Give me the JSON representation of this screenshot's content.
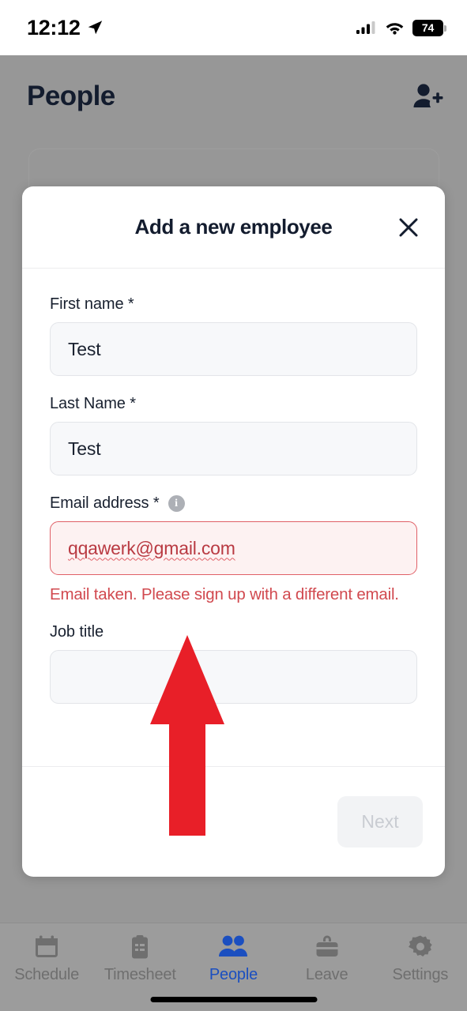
{
  "status_bar": {
    "time": "12:12",
    "location_icon": "location-arrow-icon",
    "cellular_icon": "cellular-bars-icon",
    "wifi_icon": "wifi-icon",
    "battery_level": "74"
  },
  "app_header": {
    "title": "People",
    "add_person_icon": "add-person-icon"
  },
  "modal": {
    "title": "Add a new employee",
    "close_icon": "close-x-icon",
    "fields": [
      {
        "label": "First name *",
        "value": "Test",
        "placeholder": "",
        "state": "normal"
      },
      {
        "label": "Last Name *",
        "value": "Test",
        "placeholder": "",
        "state": "normal"
      },
      {
        "label": "Email address *",
        "value": "qqawerk@gmail.com",
        "placeholder": "",
        "state": "error",
        "info_icon": "info-circle-icon",
        "error_message": "Email taken. Please sign up with a different email."
      },
      {
        "label": "Job title",
        "value": "",
        "placeholder": "",
        "state": "empty"
      }
    ],
    "next_label": "Next",
    "next_disabled": true
  },
  "annotation": {
    "arrow_icon": "red-up-arrow-annotation",
    "color": "#e81f28"
  },
  "bottom_nav": {
    "active": "People",
    "items": [
      {
        "label": "Schedule",
        "icon": "calendar-icon"
      },
      {
        "label": "Timesheet",
        "icon": "clipboard-icon"
      },
      {
        "label": "People",
        "icon": "people-icon"
      },
      {
        "label": "Leave",
        "icon": "briefcase-icon"
      },
      {
        "label": "Settings",
        "icon": "gear-icon"
      }
    ]
  },
  "colors": {
    "accent": "#1b4fc0",
    "error": "#d1494f",
    "error_border": "#e06067",
    "error_bg": "#fdf2f2",
    "overlay": "#979797"
  }
}
